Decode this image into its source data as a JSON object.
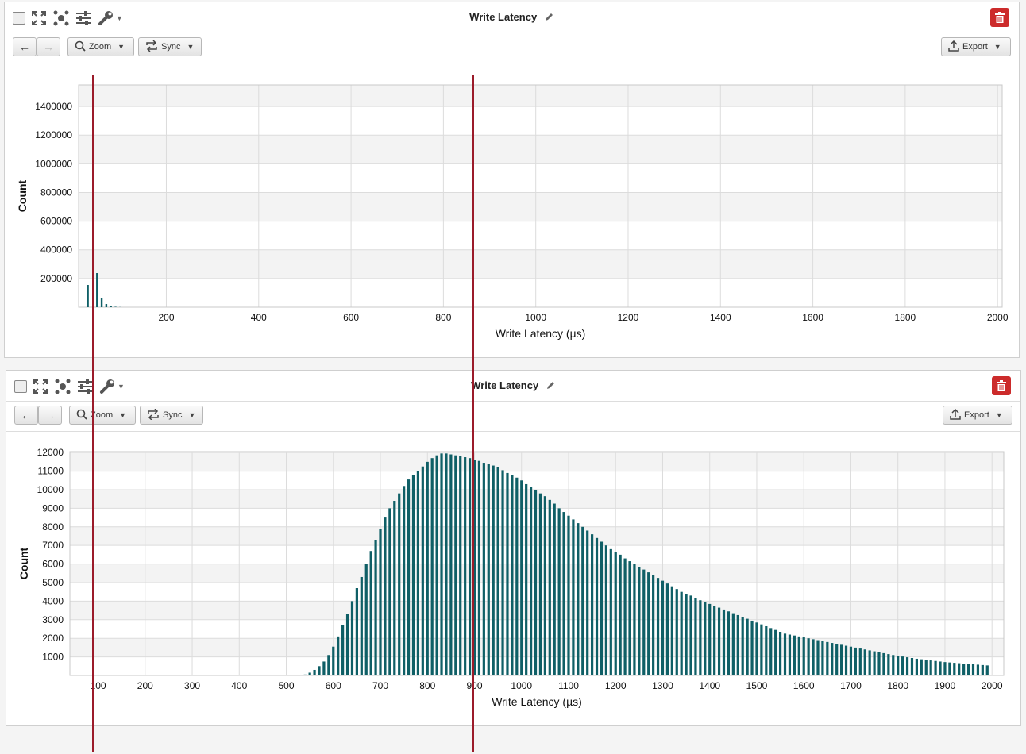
{
  "panels": [
    {
      "title": "Write Latency",
      "toolbar": {
        "zoom_label": "Zoom",
        "sync_label": "Sync",
        "export_label": "Export"
      }
    },
    {
      "title": "Write Latency",
      "toolbar": {
        "zoom_label": "Zoom",
        "sync_label": "Sync",
        "export_label": "Export"
      }
    }
  ],
  "colors": {
    "bar": "#0f5f66",
    "marker": "#9b1b2a",
    "delete_button": "#cc2b2b"
  },
  "icons": [
    "checkbox",
    "expand-icon",
    "network-icon",
    "sliders-icon",
    "wrench-icon",
    "pencil-icon",
    "trash-icon",
    "back-arrow-icon",
    "forward-arrow-icon",
    "search-icon",
    "sync-icon",
    "export-icon"
  ],
  "chart_data": [
    {
      "type": "bar",
      "xlabel": "Write Latency (µs)",
      "ylabel": "Count",
      "xlim": [
        10,
        2010
      ],
      "ylim": [
        0,
        1550000
      ],
      "xticks": [
        200,
        400,
        600,
        800,
        1000,
        1200,
        1400,
        1600,
        1800,
        2000
      ],
      "yticks": [
        200000,
        400000,
        600000,
        800000,
        1000000,
        1200000,
        1400000
      ],
      "grid": true,
      "x": [
        30,
        50,
        60,
        70,
        80,
        90,
        100
      ],
      "values": [
        155000,
        238000,
        62000,
        22000,
        8000,
        3000,
        1000
      ]
    },
    {
      "type": "bar",
      "xlabel": "Write Latency (µs)",
      "ylabel": "Count",
      "xlim": [
        40,
        2025
      ],
      "ylim": [
        0,
        12050
      ],
      "xticks": [
        100,
        200,
        300,
        400,
        500,
        600,
        700,
        800,
        900,
        1000,
        1100,
        1200,
        1300,
        1400,
        1500,
        1600,
        1700,
        1800,
        1900,
        2000
      ],
      "yticks": [
        1000,
        2000,
        3000,
        4000,
        5000,
        6000,
        7000,
        8000,
        9000,
        10000,
        11000,
        12000
      ],
      "grid": true,
      "bin_width": 10,
      "x_start": 540,
      "values": [
        50,
        150,
        300,
        500,
        750,
        1100,
        1550,
        2100,
        2700,
        3300,
        4000,
        4700,
        5300,
        6000,
        6700,
        7300,
        7900,
        8500,
        9000,
        9400,
        9800,
        10200,
        10550,
        10800,
        11000,
        11250,
        11500,
        11700,
        11850,
        11950,
        11950,
        11900,
        11850,
        11800,
        11750,
        11700,
        11600,
        11550,
        11450,
        11400,
        11300,
        11200,
        11050,
        10900,
        10800,
        10650,
        10500,
        10300,
        10150,
        10000,
        9800,
        9650,
        9450,
        9250,
        9000,
        8800,
        8600,
        8400,
        8200,
        8000,
        7800,
        7600,
        7400,
        7200,
        7000,
        6800,
        6650,
        6500,
        6300,
        6150,
        6000,
        5850,
        5700,
        5550,
        5400,
        5250,
        5100,
        4950,
        4800,
        4650,
        4500,
        4400,
        4300,
        4150,
        4050,
        3950,
        3850,
        3750,
        3650,
        3550,
        3450,
        3350,
        3250,
        3150,
        3050,
        2950,
        2850,
        2750,
        2650,
        2550,
        2450,
        2350,
        2250,
        2200,
        2150,
        2100,
        2050,
        2000,
        1950,
        1900,
        1850,
        1800,
        1750,
        1700,
        1650,
        1600,
        1550,
        1500,
        1450,
        1400,
        1350,
        1300,
        1250,
        1200,
        1150,
        1100,
        1060,
        1020,
        980,
        940,
        900,
        870,
        840,
        810,
        780,
        750,
        720,
        700,
        680,
        660,
        640,
        620,
        600,
        580,
        560,
        540
      ]
    }
  ]
}
